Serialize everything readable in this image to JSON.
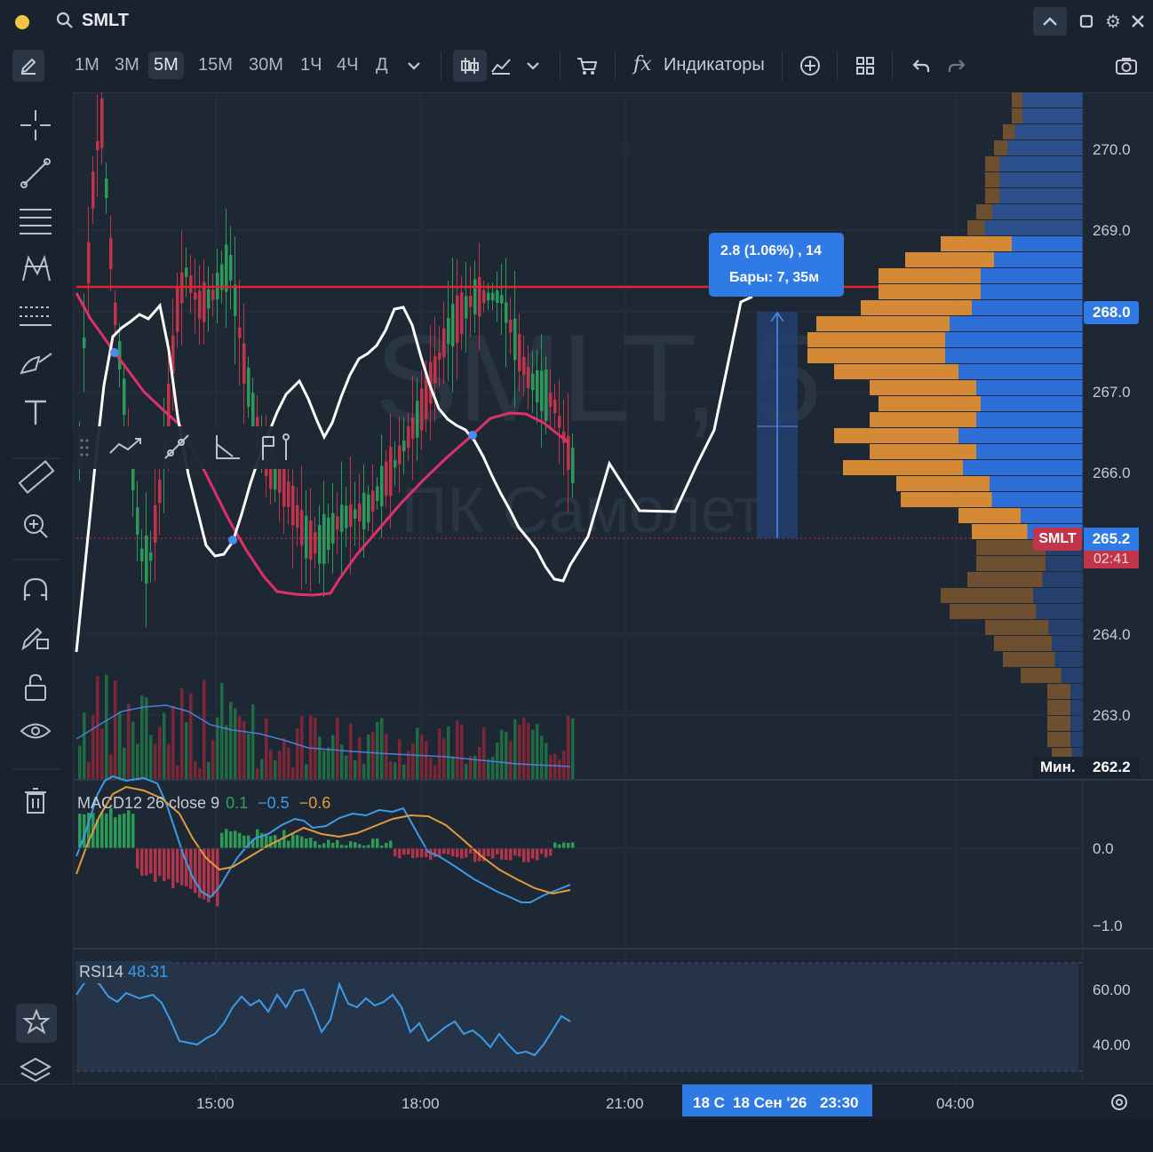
{
  "topbar": {
    "symbol": "SMLT"
  },
  "toolbar": {
    "timeframes": [
      "1M",
      "3M",
      "5M",
      "15M",
      "30M",
      "1Ч",
      "4Ч",
      "Д"
    ],
    "active_timeframe": "5M",
    "indicators_label": "Индикаторы"
  },
  "chart": {
    "watermark_symbol": "SMLT, 5",
    "watermark_name": "ПК Самолет",
    "price_axis": [
      "270.0",
      "269.0",
      "268.0",
      "267.0",
      "266.0",
      "264.0",
      "263.0"
    ],
    "highlight_price": "268.0",
    "current_symbol": "SMLT",
    "current_price": "265.2",
    "countdown": "02:41",
    "min_label": "Мин.",
    "min_price": "262.2",
    "measure_tooltip": {
      "line1": "2.8 (1.06%) , 14",
      "line2": "Бары: 7, 35м"
    }
  },
  "macd": {
    "label": "MACD12 26 close 9",
    "hist": "0.1",
    "macd": "−0.5",
    "signal": "−0.6",
    "axis": [
      "0.0",
      "−1.0"
    ]
  },
  "rsi": {
    "label": "RSI14",
    "value": "48.31",
    "axis": [
      "60.00",
      "40.00"
    ]
  },
  "time_axis": {
    "labels": [
      "15:00",
      "18:00",
      "21:00",
      "04:00"
    ],
    "cursor_partial": "18 С",
    "cursor_date": "18 Сен '26",
    "cursor_time": "23:30"
  },
  "colors": {
    "up": "#2c9a5a",
    "down": "#c2344a",
    "blue": "#2d6fd6",
    "orange": "#d48a35",
    "accent": "#2f7ae5"
  }
}
